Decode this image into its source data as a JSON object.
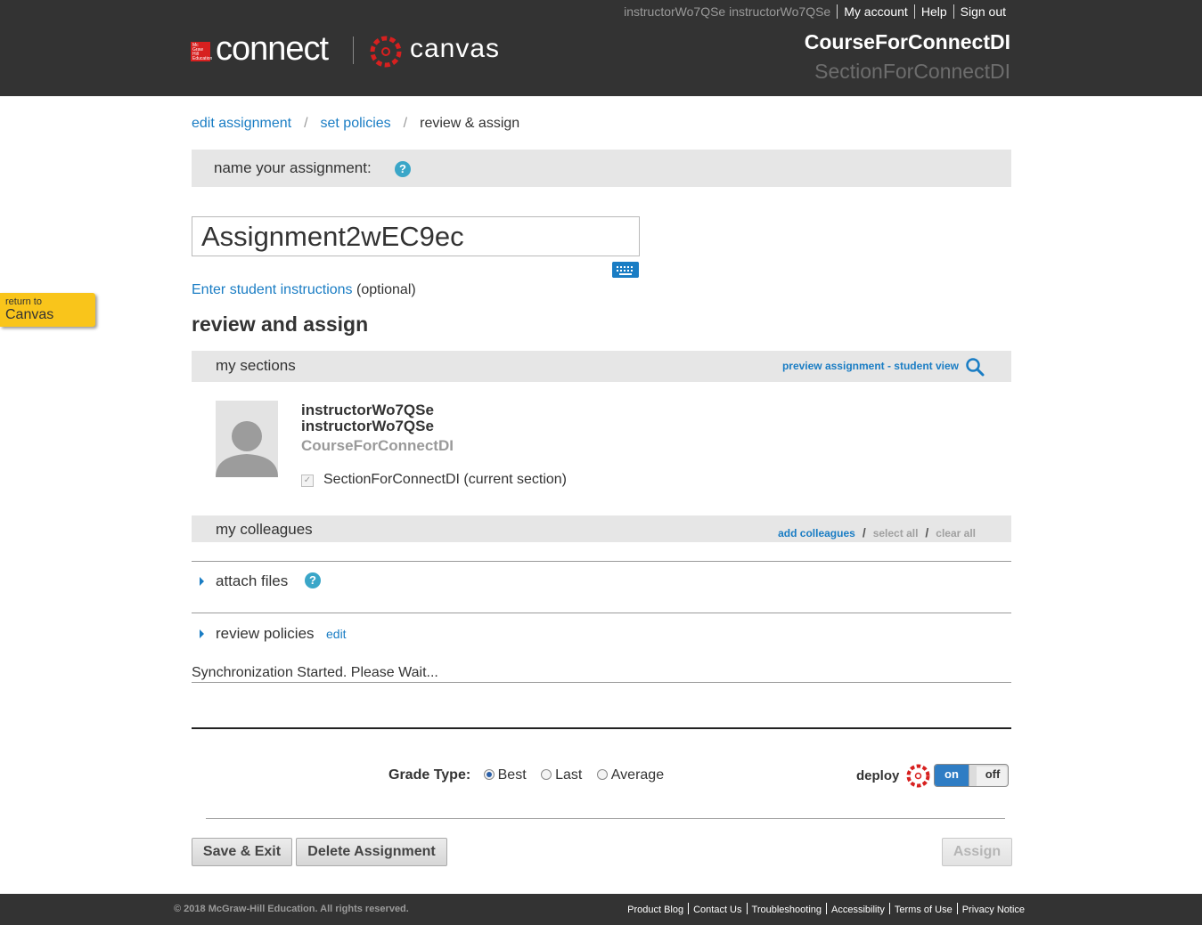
{
  "header": {
    "user_name": "instructorWo7QSe instructorWo7QSe",
    "my_account": "My account",
    "help": "Help",
    "sign_out": "Sign out",
    "connect_logo_text": "connect",
    "canvas_logo_text": "canvas",
    "mh_logo_text": "Mc Graw Hill Education",
    "course_title": "CourseForConnectDI",
    "section_title": "SectionForConnectDI",
    "canvas_brand_color": "#d7201f"
  },
  "breadcrumb": {
    "step1": "edit assignment",
    "step2": "set policies",
    "step3": "review & assign",
    "separator": "/"
  },
  "name_section": {
    "label": "name your assignment:",
    "help_icon": "?",
    "assignment_name": "Assignment2wEC9ec",
    "keyboard_icon": "keyboard-icon"
  },
  "instructions": {
    "link": "Enter student instructions",
    "suffix": "(optional)"
  },
  "return_tab": {
    "small": "return to",
    "big": "Canvas"
  },
  "review": {
    "heading": "review and assign",
    "my_sections": "my sections",
    "preview_link": "preview assignment - student view",
    "instructor_first": "instructorWo7QSe",
    "instructor_last": "instructorWo7QSe",
    "course": "CourseForConnectDI",
    "section_label": "SectionForConnectDI (current section)",
    "section_checked": true
  },
  "colleagues": {
    "label": "my colleagues",
    "add": "add colleagues",
    "select_all": "select all",
    "clear_all": "clear all",
    "separator": "/"
  },
  "attach": {
    "label": "attach files",
    "help_icon": "?"
  },
  "policies": {
    "label": "review policies",
    "edit": "edit"
  },
  "sync_message": "Synchronization Started. Please Wait...",
  "grade_type": {
    "label": "Grade Type:",
    "options": [
      "Best",
      "Last",
      "Average"
    ],
    "selected": "Best"
  },
  "deploy": {
    "label": "deploy",
    "on": "on",
    "off": "off",
    "state": "on"
  },
  "buttons": {
    "save_exit": "Save & Exit",
    "delete": "Delete Assignment",
    "assign": "Assign"
  },
  "footer": {
    "copyright": "© 2018 McGraw-Hill Education. All rights reserved.",
    "links": [
      "Product Blog",
      "Contact Us",
      "Troubleshooting",
      "Accessibility",
      "Terms of Use",
      "Privacy Notice"
    ]
  },
  "colors": {
    "header_bg": "#333333",
    "link": "#1a7dc4",
    "return_tab": "#f9c51b",
    "toggle_on": "#2f7dc4"
  }
}
